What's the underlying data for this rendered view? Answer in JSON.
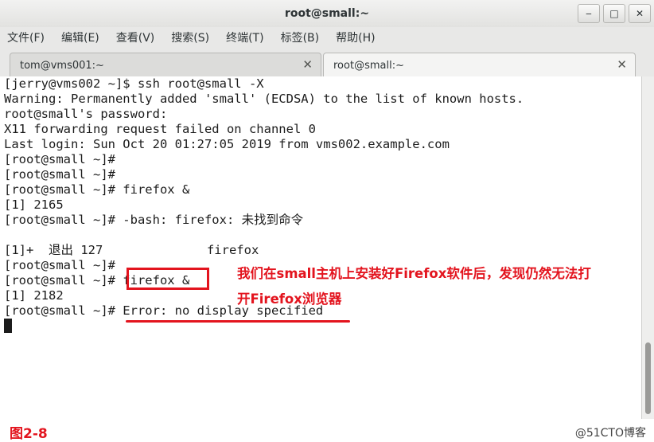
{
  "window": {
    "title": "root@small:~",
    "buttons": {
      "minimize": "‒",
      "maximize": "□",
      "close": "✕"
    }
  },
  "menubar": [
    "文件(F)",
    "编辑(E)",
    "查看(V)",
    "搜索(S)",
    "终端(T)",
    "标签(B)",
    "帮助(H)"
  ],
  "tabs": [
    {
      "label": "tom@vms001:~",
      "close": "✕",
      "active": false
    },
    {
      "label": "root@small:~",
      "close": "✕",
      "active": true
    }
  ],
  "terminal_lines": [
    "[jerry@vms002 ~]$ ssh root@small -X",
    "Warning: Permanently added 'small' (ECDSA) to the list of known hosts.",
    "root@small's password:",
    "X11 forwarding request failed on channel 0",
    "Last login: Sun Oct 20 01:27:05 2019 from vms002.example.com",
    "[root@small ~]#",
    "[root@small ~]#",
    "[root@small ~]# firefox &",
    "[1] 2165",
    "[root@small ~]# -bash: firefox: 未找到命令",
    "",
    "[1]+  退出 127              firefox",
    "[root@small ~]#",
    "[root@small ~]# firefox &",
    "[1] 2182",
    "[root@small ~]# Error: no display specified"
  ],
  "annotation": {
    "line1": "我们在small主机上安装好Firefox软件后，发现仍然无法打",
    "line2": "开Firefox浏览器"
  },
  "figure_label": "图2-8",
  "watermark": "@51CTO博客",
  "colors": {
    "accent": "#e3141e",
    "terminal_bg": "#ffffff",
    "terminal_fg": "#1c1c1c"
  }
}
